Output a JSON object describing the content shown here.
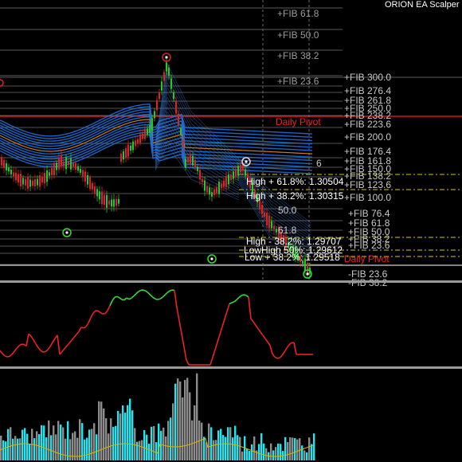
{
  "title": "ORION EA Scalper (",
  "colors": {
    "background": "#000000",
    "fib_label": "#c8c8c8",
    "fib_label_dim": "#9a9a9a",
    "daily_pivot": "#ff1a1a",
    "yellow_level": "#d6c800",
    "bull_candle": "#22cc22",
    "bear_candle": "#dd2222",
    "ribbon": "#1e6fd9",
    "osc_up": "#33dd33",
    "osc_down": "#ee2222",
    "hist_cyan": "#22e5ef",
    "hist_gray": "#8c8c8c",
    "hist_ma": "#d8b800",
    "panel_separator": "#9a9a9a"
  },
  "upper_fib_labels": [
    "+FIB 61.8",
    "+FIB 50.0",
    "+FIB 38.2",
    "+FIB 23.6"
  ],
  "right_fib_labels_top": [
    "+FIB 300.0",
    "+FIB 276.4",
    "+FIB 261.8",
    "+FIB 250.0",
    "+FIB 238.2",
    "+FIB 223.6",
    "+FIB 200.0",
    "+FIB 176.4",
    "+FIB 161.8",
    "+FIB 150.0",
    "+FIB 138.2",
    "+FIB 123.6",
    "+FIB 100.0"
  ],
  "right_fib_labels_mid": [
    "+FIB 76.4",
    "+FIB 61.8",
    "+FIB 50.0",
    "+FIB 38.2",
    "+FIB 23.6"
  ],
  "ribbon_fib_labels": [
    "6",
    "50.0",
    "61.8"
  ],
  "right_fib_labels_bottom": [
    "-FIB 23.6",
    "-FIB 38.2"
  ],
  "daily_pivot_label": "Daily Pivot",
  "daily_pivot_label_lower": "Daily Pivot",
  "level_labels": [
    "High + 61.8%: 1.30504",
    "High + 38.2%: 1.30315",
    "High - 38.2%: 1.29707",
    "LowHigh 50%: 1.29612",
    "Low + 38.2%: 1.29518"
  ]
}
